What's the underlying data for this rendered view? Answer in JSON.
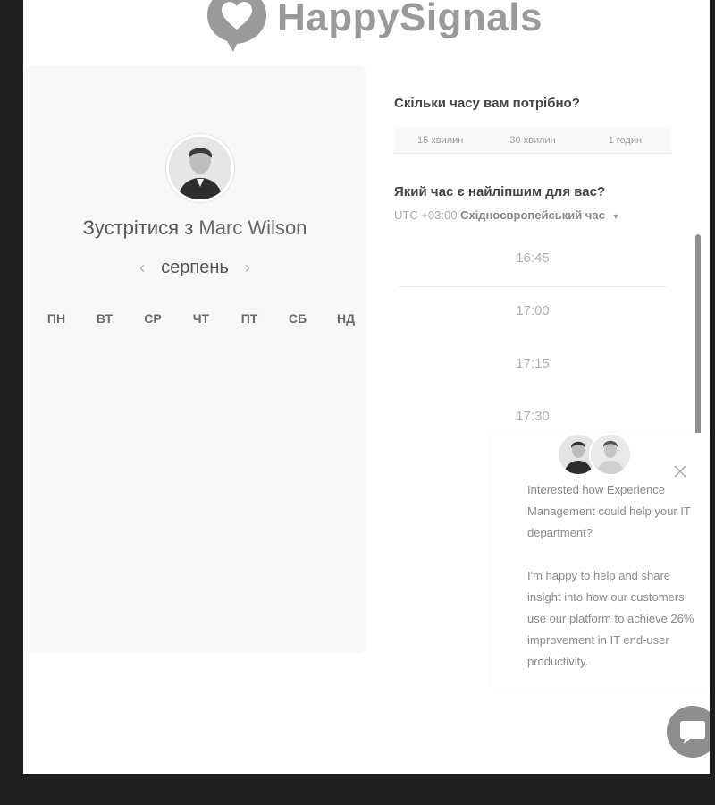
{
  "brand": {
    "name": "HappySignals"
  },
  "booking": {
    "meet_prefix": "Зустрітися з",
    "host": "Marc Wilson",
    "month": "серпень",
    "weekdays": [
      "ПН",
      "ВТ",
      "СР",
      "ЧТ",
      "ПТ",
      "СБ",
      "НД"
    ]
  },
  "duration": {
    "question": "Скільки часу вам потрібно?",
    "options": [
      "15 хвилин",
      "30 хвилин",
      "1 годин"
    ]
  },
  "time": {
    "question": "Який час є найліпшим для вас?",
    "tz_offset": "UTC +03:00",
    "tz_name": "Східноєвропейський час",
    "slots": [
      "16:45",
      "17:00",
      "17:15",
      "17:30"
    ]
  },
  "chat": {
    "paragraph1": "Interested how Experience Management could help your IT department?",
    "paragraph2": "I'm happy to help and share insight into how our customers use our platform to achieve 26% improvement in IT end-user productivity."
  },
  "icons": {
    "logo": "heart-speech-bubble-icon",
    "prev": "chevron-left-icon",
    "next": "chevron-right-icon",
    "caret": "caret-down-icon",
    "close": "close-icon",
    "chat": "chat-bubble-icon"
  },
  "colors": {
    "logo": "#9a9a9a",
    "chat_button": "#8e8e8e"
  }
}
